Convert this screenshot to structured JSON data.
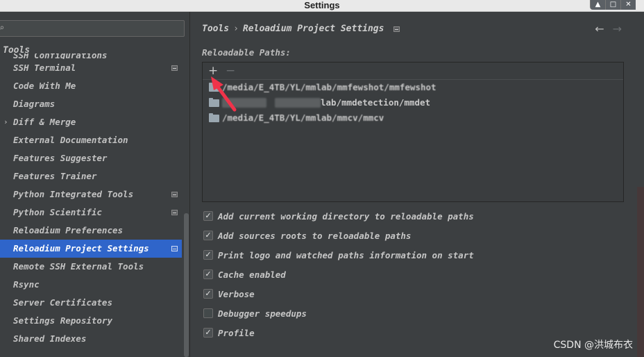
{
  "window": {
    "title": "Settings",
    "controls": [
      "▲",
      "□",
      "✕"
    ]
  },
  "sidebar": {
    "search_placeholder": "",
    "group": "Tools",
    "items": [
      {
        "label": "SSH Configurations",
        "indicator": true,
        "partial": true
      },
      {
        "label": "SSH Terminal",
        "indicator": true
      },
      {
        "label": "Code With Me",
        "indicator": false
      },
      {
        "label": "Diagrams",
        "indicator": false
      },
      {
        "label": "Diff & Merge",
        "indicator": false,
        "expandable": true
      },
      {
        "label": "External Documentation",
        "indicator": false
      },
      {
        "label": "Features Suggester",
        "indicator": false
      },
      {
        "label": "Features Trainer",
        "indicator": false
      },
      {
        "label": "Python Integrated Tools",
        "indicator": true
      },
      {
        "label": "Python Scientific",
        "indicator": true
      },
      {
        "label": "Reloadium Preferences",
        "indicator": false
      },
      {
        "label": "Reloadium Project Settings",
        "indicator": true,
        "selected": true
      },
      {
        "label": "Remote SSH External Tools",
        "indicator": false
      },
      {
        "label": "Rsync",
        "indicator": false
      },
      {
        "label": "Server Certificates",
        "indicator": false
      },
      {
        "label": "Settings Repository",
        "indicator": false
      },
      {
        "label": "Shared Indexes",
        "indicator": false
      }
    ]
  },
  "main": {
    "breadcrumb": [
      "Tools",
      "Reloadium Project Settings"
    ],
    "breadcrumb_sep": "›",
    "nav_back": "←",
    "nav_forward": "→",
    "section_label": "Reloadable Paths:",
    "toolbar": {
      "add": "+",
      "remove": "−"
    },
    "paths": [
      {
        "visible_text": "/media/E_4TB/YL/mmlab/mmfewshot/mmfewshot",
        "prefix": "/",
        "suffix": "lab/mmfewshot/mmfewshot"
      },
      {
        "visible_text": "lab/mmdetection/mmdet",
        "prefix": "",
        "suffix": "lab/mmdetection/mmdet"
      },
      {
        "visible_text": "/media/E_4TB/YL/mmlab/mmcv/mmcv",
        "prefix": "",
        "suffix": "/media/E_4TB/YL/mmlab/mmcv/mmcv"
      }
    ],
    "options": [
      {
        "label": "Add current working directory to reloadable paths",
        "checked": true
      },
      {
        "label": "Add sources roots to reloadable paths",
        "checked": true
      },
      {
        "label": "Print logo and watched paths information on start",
        "checked": true
      },
      {
        "label": "Cache enabled",
        "checked": true
      },
      {
        "label": "Verbose",
        "checked": true
      },
      {
        "label": "Debugger speedups",
        "checked": false
      },
      {
        "label": "Profile",
        "checked": true
      }
    ]
  },
  "watermark": "CSDN @洪城布衣",
  "colors": {
    "background": "#3c3f41",
    "selection": "#2f65ca",
    "annotation_arrow": "#f0334a"
  }
}
